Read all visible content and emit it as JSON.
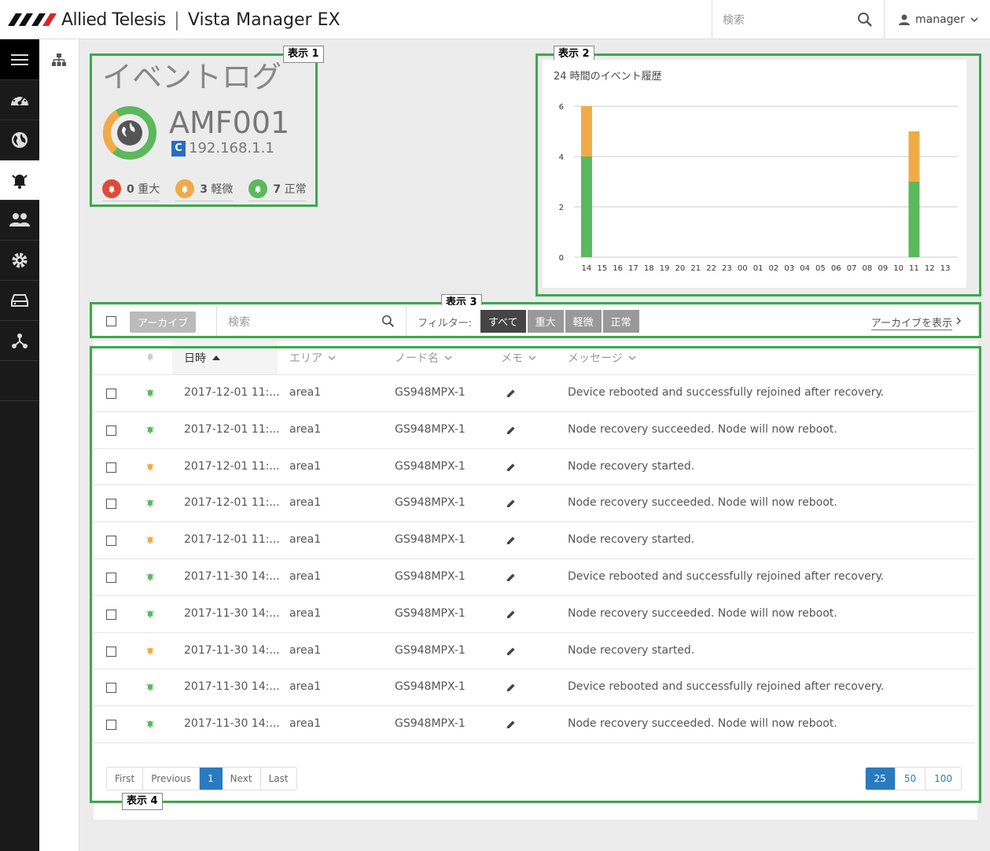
{
  "header": {
    "brand": "Allied Telesis",
    "separator": "|",
    "app_title": "Vista Manager EX",
    "search_placeholder": "検索",
    "user": "manager"
  },
  "annotations": {
    "display1": "表示 1",
    "display2": "表示 2",
    "display3": "表示 3",
    "display4": "表示 4"
  },
  "summary": {
    "title": "イベントログ",
    "device_name": "AMF001",
    "device_badge": "C",
    "device_ip": "192.168.1.1",
    "counts": [
      {
        "value": "0",
        "label": "重大",
        "color": "#e04a3a"
      },
      {
        "value": "3",
        "label": "軽微",
        "color": "#f0ab48"
      },
      {
        "value": "7",
        "label": "正常",
        "color": "#5cb85c"
      }
    ]
  },
  "chart_data": {
    "type": "bar",
    "title": "24 時間のイベント履歴",
    "categories": [
      "14",
      "15",
      "16",
      "17",
      "18",
      "19",
      "20",
      "21",
      "22",
      "23",
      "00",
      "01",
      "02",
      "03",
      "04",
      "05",
      "06",
      "07",
      "08",
      "09",
      "10",
      "11",
      "12",
      "13"
    ],
    "series": [
      {
        "color": "#5cb85c",
        "values": [
          4,
          0,
          0,
          0,
          0,
          0,
          0,
          0,
          0,
          0,
          0,
          0,
          0,
          0,
          0,
          0,
          0,
          0,
          0,
          0,
          0,
          3,
          0,
          0
        ]
      },
      {
        "color": "#f0ab48",
        "values": [
          2,
          0,
          0,
          0,
          0,
          0,
          0,
          0,
          0,
          0,
          0,
          0,
          0,
          0,
          0,
          0,
          0,
          0,
          0,
          0,
          0,
          2,
          0,
          0
        ]
      }
    ],
    "stacked": true,
    "ylim": [
      0,
      6
    ],
    "yticks": [
      "0",
      "2",
      "4",
      "6"
    ],
    "grid": true
  },
  "filter": {
    "archive_label": "アーカイブ",
    "search_placeholder": "検索",
    "filter_label": "フィルター:",
    "buttons": [
      "すべて",
      "重大",
      "軽微",
      "正常"
    ],
    "active": "すべて",
    "show_archive": "アーカイブを表示"
  },
  "table": {
    "columns": {
      "datetime": "日時",
      "area": "エリア",
      "node": "ノード名",
      "memo": "メモ",
      "message": "メッセージ"
    },
    "rows": [
      {
        "level": "green",
        "datetime": "2017-12-01 11:...",
        "area": "area1",
        "node": "GS948MPX-1",
        "message": "Device rebooted and successfully rejoined after recovery."
      },
      {
        "level": "green",
        "datetime": "2017-12-01 11:...",
        "area": "area1",
        "node": "GS948MPX-1",
        "message": "Node recovery succeeded. Node will now reboot."
      },
      {
        "level": "orange",
        "datetime": "2017-12-01 11:...",
        "area": "area1",
        "node": "GS948MPX-1",
        "message": "Node recovery started."
      },
      {
        "level": "green",
        "datetime": "2017-12-01 11:...",
        "area": "area1",
        "node": "GS948MPX-1",
        "message": "Node recovery succeeded. Node will now reboot."
      },
      {
        "level": "orange",
        "datetime": "2017-12-01 11:...",
        "area": "area1",
        "node": "GS948MPX-1",
        "message": "Node recovery started."
      },
      {
        "level": "green",
        "datetime": "2017-11-30 14:...",
        "area": "area1",
        "node": "GS948MPX-1",
        "message": "Device rebooted and successfully rejoined after recovery."
      },
      {
        "level": "green",
        "datetime": "2017-11-30 14:...",
        "area": "area1",
        "node": "GS948MPX-1",
        "message": "Node recovery succeeded. Node will now reboot."
      },
      {
        "level": "orange",
        "datetime": "2017-11-30 14:...",
        "area": "area1",
        "node": "GS948MPX-1",
        "message": "Node recovery started."
      },
      {
        "level": "green",
        "datetime": "2017-11-30 14:...",
        "area": "area1",
        "node": "GS948MPX-1",
        "message": "Device rebooted and successfully rejoined after recovery."
      },
      {
        "level": "green",
        "datetime": "2017-11-30 14:...",
        "area": "area1",
        "node": "GS948MPX-1",
        "message": "Node recovery succeeded. Node will now reboot."
      }
    ]
  },
  "pagination": {
    "buttons": [
      "First",
      "Previous",
      "1",
      "Next",
      "Last"
    ],
    "current": "1",
    "sizes": [
      "25",
      "50",
      "100"
    ],
    "size_current": "25"
  },
  "colors": {
    "green": "#5cb85c",
    "orange": "#f0ab48",
    "red": "#e04a3a",
    "accent": "#2a7ac0",
    "box": "#3aaa4a"
  }
}
